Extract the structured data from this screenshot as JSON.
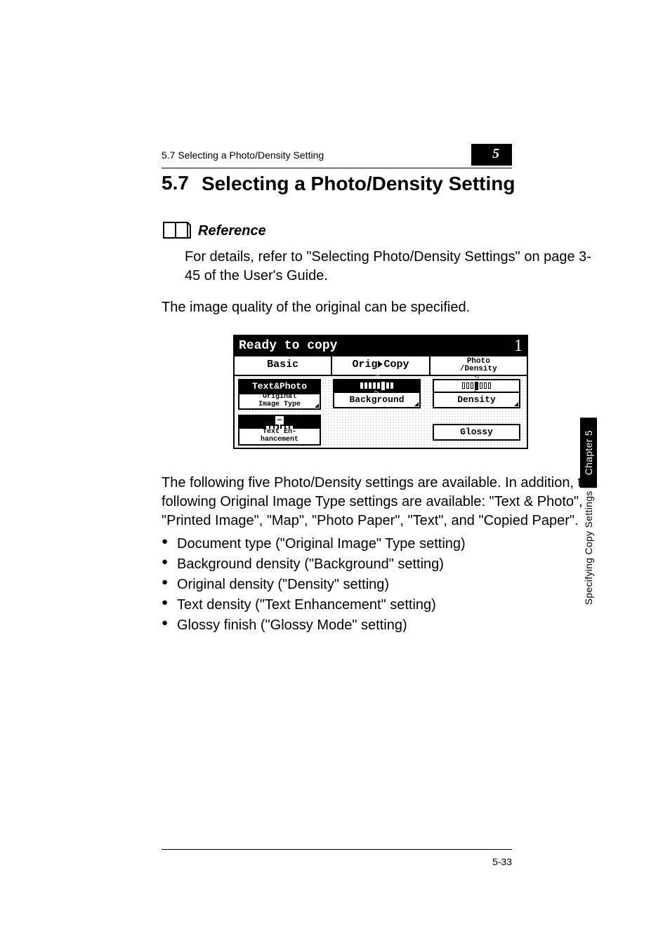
{
  "header": {
    "running_text": "5.7 Selecting a Photo/Density Setting",
    "chapter_badge": "5"
  },
  "section": {
    "number": "5.7",
    "title": "Selecting a Photo/Density Setting"
  },
  "reference": {
    "label": "Reference",
    "text": "For details, refer to \"Selecting Photo/Density Settings\" on page 3-45 of the User's Guide."
  },
  "intro_text": "The image quality of the original can be specified.",
  "lcd": {
    "status": "Ready to copy",
    "status_number": "1",
    "tabs": {
      "basic": "Basic",
      "orig_copy_left": "Orig",
      "orig_copy_right": "Copy",
      "photo_density_top": "Photo",
      "photo_density_bottom": "/Density"
    },
    "buttons": {
      "text_photo": "Text&Photo",
      "original_image_type_l1": "Original",
      "original_image_type_l2": "Image Type",
      "background": "Background",
      "density": "Density",
      "text_enh_l1": "Text En-",
      "text_enh_l2": "hancement",
      "glossy": "Glossy"
    }
  },
  "after_text": "The following five Photo/Density settings are available. In addition, the following Original Image Type settings are available: \"Text & Photo\", \"Printed Image\", \"Map\", \"Photo Paper\", \"Text\", and \"Copied Paper\".",
  "settings_list": [
    "Document type (\"Original Image\" Type setting)",
    "Background density (\"Background\" setting)",
    "Original density (\"Density\" setting)",
    "Text density (\"Text Enhancement\" setting)",
    "Glossy finish (\"Glossy Mode\" setting)"
  ],
  "footer": {
    "page_number": "5-33"
  },
  "side_tab": {
    "text": "Specifying Copy Settings",
    "chapter": "Chapter 5"
  }
}
